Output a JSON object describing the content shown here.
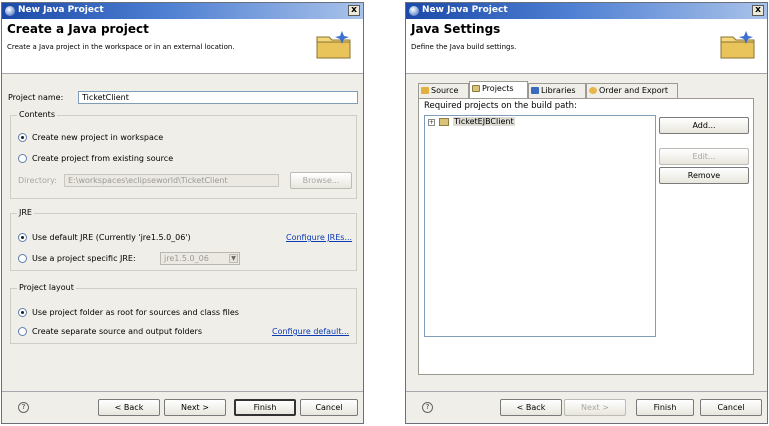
{
  "dialog1": {
    "window_title": "New Java Project",
    "close_label": "x",
    "header_title": "Create a Java project",
    "header_description": "Create a Java project in the workspace or in an external location.",
    "project_name_label": "Project name:",
    "project_name_value": "TicketClient",
    "contents": {
      "group_label": "Contents",
      "option_new": "Create new project in workspace",
      "option_existing": "Create project from existing source",
      "directory_label": "Directory:",
      "directory_value": "E:\\workspaces\\eclipseworld\\TicketClient",
      "browse_label": "Browse..."
    },
    "jre": {
      "group_label": "JRE",
      "option_default": "Use default JRE (Currently 'jre1.5.0_06')",
      "configure_link": "Configure JREs...",
      "option_specific": "Use a project specific JRE:",
      "specific_value": "jre1.5.0_06"
    },
    "layout": {
      "group_label": "Project layout",
      "option_root": "Use project folder as root for sources and class files",
      "option_separate": "Create separate source and output folders",
      "configure_link": "Configure default..."
    },
    "buttons": {
      "back": "< Back",
      "next": "Next >",
      "finish": "Finish",
      "cancel": "Cancel"
    }
  },
  "dialog2": {
    "window_title": "New Java Project",
    "close_label": "x",
    "header_title": "Java Settings",
    "header_description": "Define the Java build settings.",
    "tabs": [
      {
        "label": "Source",
        "active": false
      },
      {
        "label": "Projects",
        "active": true
      },
      {
        "label": "Libraries",
        "active": false
      },
      {
        "label": "Order and Export",
        "active": false
      }
    ],
    "required_label": "Required projects on the build path:",
    "tree_expander": "+",
    "tree_item": "TicketEJBClient",
    "side_buttons": {
      "add": "Add...",
      "edit": "Edit...",
      "remove": "Remove"
    },
    "buttons": {
      "back": "< Back",
      "next": "Next >",
      "finish": "Finish",
      "cancel": "Cancel"
    }
  },
  "icons": {
    "window": "eclipse-icon",
    "wizard": "folder-wizard-icon",
    "help": "help-icon",
    "help_glyph": "?",
    "combo_arrow_glyph": "▼"
  },
  "colors": {
    "titlebar_start": "#1b49a8",
    "titlebar_end": "#a9c2ea",
    "link": "#0b3bb5",
    "dialog_bg": "#f0eee8"
  }
}
